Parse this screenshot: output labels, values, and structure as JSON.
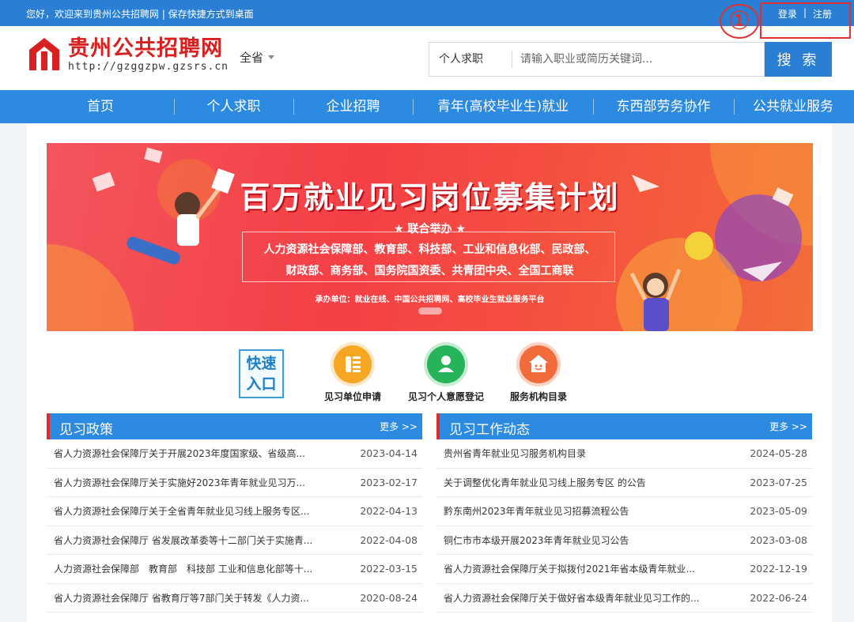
{
  "topbar": {
    "welcome": "您好，欢迎来到贵州公共招聘网 | 保存快捷方式到桌面",
    "login": "登录",
    "separator": "|",
    "register": "注册",
    "annotation_number": "①",
    "annotation_color": "#e03030"
  },
  "header": {
    "logo_title": "贵州公共招聘网",
    "logo_url": "http://gzggzpw.gzsrs.cn",
    "region": "全省",
    "search_type": "个人求职",
    "search_placeholder": "请输入职业或简历关键词...",
    "search_button": "搜 索"
  },
  "nav": [
    "首页",
    "个人求职",
    "企业招聘",
    "青年(高校毕业生)就业",
    "东西部劳务协作",
    "公共就业服务"
  ],
  "banner": {
    "title": "百万就业见习岗位募集计划",
    "sub": "★ 联合举办 ★",
    "line1": "人力资源社会保障部、教育部、科技部、工业和信息化部、民政部、",
    "line2": "财政部、商务部、国务院国资委、共青团中央、全国工商联",
    "host": "承办单位：就业在线、中国公共招聘网、高校毕业生就业服务平台"
  },
  "quick": {
    "badge_line1": "快速",
    "badge_line2": "入口",
    "items": [
      {
        "label": "见习单位申请",
        "icon": "document-list-icon",
        "color": "#f5a623"
      },
      {
        "label": "见习个人意愿登记",
        "icon": "person-icon",
        "color": "#27b35a"
      },
      {
        "label": "服务机构目录",
        "icon": "house-icon",
        "color": "#f26b3a"
      }
    ]
  },
  "policy": {
    "title": "见习政策",
    "more": "更多 >>",
    "rows": [
      {
        "title": "省人力资源社会保障厅关于开展2023年度国家级、省级高...",
        "date": "2023-04-14"
      },
      {
        "title": "省人力资源社会保障厅关于实施好2023年青年就业见习万...",
        "date": "2023-02-17"
      },
      {
        "title": "省人力资源社会保障厅关于全省青年就业见习线上服务专区...",
        "date": "2022-04-13"
      },
      {
        "title": "省人力资源社会保障厅 省发展改革委等十二部门关于实施青...",
        "date": "2022-04-08"
      },
      {
        "title": "人力资源社会保障部　教育部　科技部 工业和信息化部等十...",
        "date": "2022-03-15"
      },
      {
        "title": "省人力资源社会保障厅 省教育厅等7部门关于转发《人力资...",
        "date": "2020-08-24"
      }
    ]
  },
  "news": {
    "title": "见习工作动态",
    "more": "更多 >>",
    "rows": [
      {
        "title": "贵州省青年就业见习服务机构目录",
        "date": "2024-05-28"
      },
      {
        "title": "关于调整优化青年就业见习线上服务专区 的公告",
        "date": "2023-07-25"
      },
      {
        "title": "黔东南州2023年青年就业见习招募流程公告",
        "date": "2023-05-09"
      },
      {
        "title": "铜仁市市本级开展2023年青年就业见习公告",
        "date": "2023-03-08"
      },
      {
        "title": "省人力资源社会保障厅关于拟拨付2021年省本级青年就业...",
        "date": "2022-12-19"
      },
      {
        "title": "省人力资源社会保障厅关于做好省本级青年就业见习工作的...",
        "date": "2022-06-24"
      }
    ]
  },
  "colors": {
    "primary": "#2a7fd4",
    "nav": "#2c8ae0",
    "brand_red": "#d92020"
  }
}
